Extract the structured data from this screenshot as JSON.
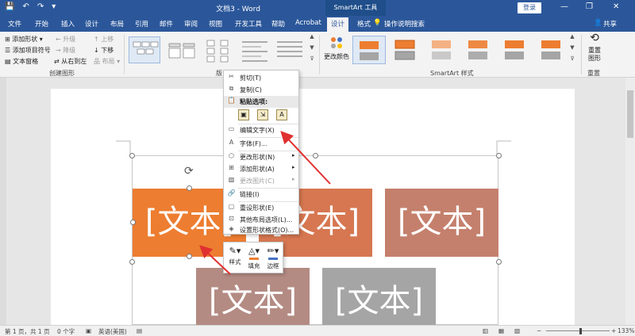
{
  "window": {
    "title": "文档3 - Word",
    "smartart_tools": "SmartArt 工具",
    "login": "登录",
    "minimize_glyph": "—",
    "restore_glyph": "❐",
    "close_glyph": "✕"
  },
  "qat": {
    "save_glyph": "💾",
    "undo_glyph": "↶",
    "redo_glyph": "↷",
    "more_glyph": "▾"
  },
  "tabs": {
    "file": "文件",
    "home": "开始",
    "insert": "插入",
    "design": "设计",
    "layout": "布局",
    "references": "引用",
    "mailings": "邮件",
    "review": "审阅",
    "view": "视图",
    "developer": "开发工具",
    "help": "帮助",
    "acrobat": "Acrobat",
    "sa_design": "设计",
    "sa_format": "格式"
  },
  "tellme": "操作说明搜索",
  "share": "共享",
  "ribbon": {
    "create_graphic": {
      "add_shape": "添加形状",
      "add_bullet": "添加项目符号",
      "text_pane": "文本窗格",
      "promote": "升级",
      "demote": "降级",
      "rtl": "从右到左",
      "move_up": "上移",
      "move_down": "下移",
      "layout_btn": "布局",
      "group_label": "创建图形"
    },
    "layouts_group_label": "版",
    "change_colors": "更改颜色",
    "styles_group_label": "SmartArt 样式",
    "reset": {
      "line1": "重置",
      "line2": "图形",
      "group_label": "重置"
    },
    "colors": {
      "accent": "#ed7d31",
      "gray": "#a5a5a5"
    }
  },
  "shapes": {
    "s1": "[文本]",
    "s2": "[文本]",
    "s3": "[文本]",
    "s4": "[文本]",
    "s5": "[文本]",
    "colors": {
      "s1": "#ed7d31",
      "s2": "#d67751",
      "s3": "#c4806d",
      "s4": "#b38b83",
      "s5": "#a5a5a5"
    }
  },
  "context_menu": {
    "cut": "剪切(T)",
    "copy": "复制(C)",
    "paste_options": "粘贴选项:",
    "edit_text": "编辑文字(X)",
    "font": "字体(F)...",
    "change_shape": "更改形状(N)",
    "add_shape": "添加形状(A)",
    "change_picture": "更改图片(C)",
    "link": "链接(I)",
    "reset_shape": "重设形状(E)",
    "more_layout": "其他布局选项(L)...",
    "format_shape": "设置形状格式(O)..."
  },
  "minibar": {
    "style": "样式",
    "fill": "填充",
    "border": "边框"
  },
  "status": {
    "page": "第 1 页，共 1 页",
    "words": "0 个字",
    "language": "英语(美国)",
    "zoom": "133%"
  }
}
